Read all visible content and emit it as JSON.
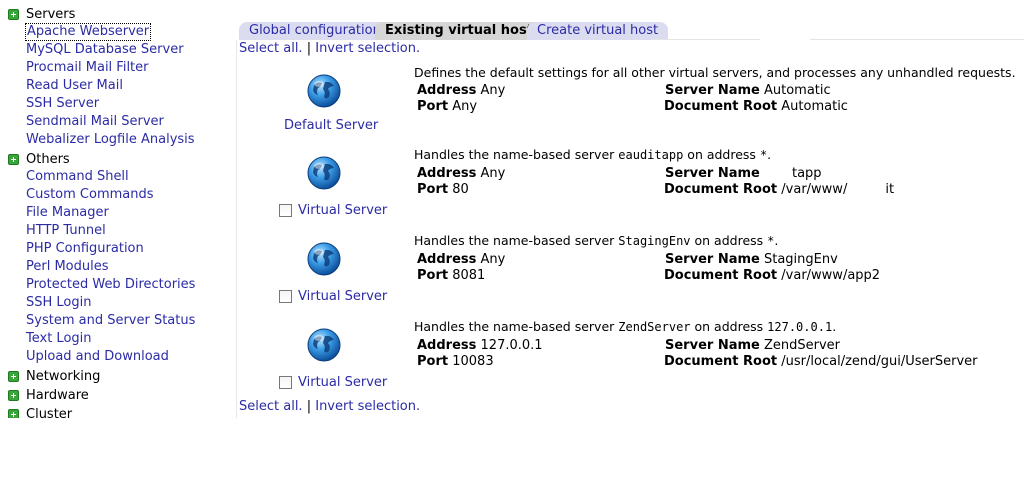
{
  "sidebar": {
    "categories": [
      {
        "label": "Servers"
      },
      {
        "label": "Others"
      },
      {
        "label": "Networking"
      },
      {
        "label": "Hardware"
      },
      {
        "label": "Cluster"
      }
    ],
    "servers_items": [
      "Apache Webserver",
      "MySQL Database Server",
      "Procmail Mail Filter",
      "Read User Mail",
      "SSH Server",
      "Sendmail Mail Server",
      "Webalizer Logfile Analysis"
    ],
    "others_items": [
      "Command Shell",
      "Custom Commands",
      "File Manager",
      "HTTP Tunnel",
      "PHP Configuration",
      "Perl Modules",
      "Protected Web Directories",
      "SSH Login",
      "System and Server Status",
      "Text Login",
      "Upload and Download"
    ]
  },
  "tabs": {
    "global": "Global configuration",
    "existing": "Existing virtual hosts",
    "create": "Create virtual host"
  },
  "select_links": {
    "select_all": "Select all.",
    "separator": "|",
    "invert": "Invert selection."
  },
  "labels": {
    "address": "Address",
    "port": "Port",
    "server_name": "Server Name",
    "document_root": "Document Root"
  },
  "servers": [
    {
      "caption": "Default Server",
      "description": "Defines the default settings for all other virtual servers, and processes any unhandled requests.",
      "address": "Any",
      "port": "Any",
      "server_name": "Automatic",
      "document_root": "Automatic"
    },
    {
      "caption": "Virtual Server",
      "desc_prefix": "Handles the name-based server",
      "desc_name": "eauditapp",
      "desc_mid": "on address",
      "desc_addr": "*",
      "desc_end": ".",
      "address": "Any",
      "port": "80",
      "server_name": "tapp",
      "doc_root_a": "/var/www/",
      "doc_root_b": "it"
    },
    {
      "caption": "Virtual Server",
      "desc_prefix": "Handles the name-based server",
      "desc_name": "StagingEnv",
      "desc_mid": "on address",
      "desc_addr": "*",
      "desc_end": ".",
      "address": "Any",
      "port": "8081",
      "server_name": "StagingEnv",
      "document_root": "/var/www/app2"
    },
    {
      "caption": "Virtual Server",
      "desc_prefix": "Handles the name-based server",
      "desc_name": "ZendServer",
      "desc_mid": "on address",
      "desc_addr": "127.0.0.1",
      "desc_end": ".",
      "address": "127.0.0.1",
      "port": "10083",
      "server_name": "ZendServer",
      "document_root": "/usr/local/zend/gui/UserServer"
    }
  ],
  "colors": {
    "link": "#2b2ba6",
    "tab_inactive": "#dcdcf0",
    "tab_active": "#d6d6d6",
    "category_icon": "#3aa53a"
  },
  "icons": {
    "category": "plus-box-icon",
    "server": "globe-icon"
  }
}
